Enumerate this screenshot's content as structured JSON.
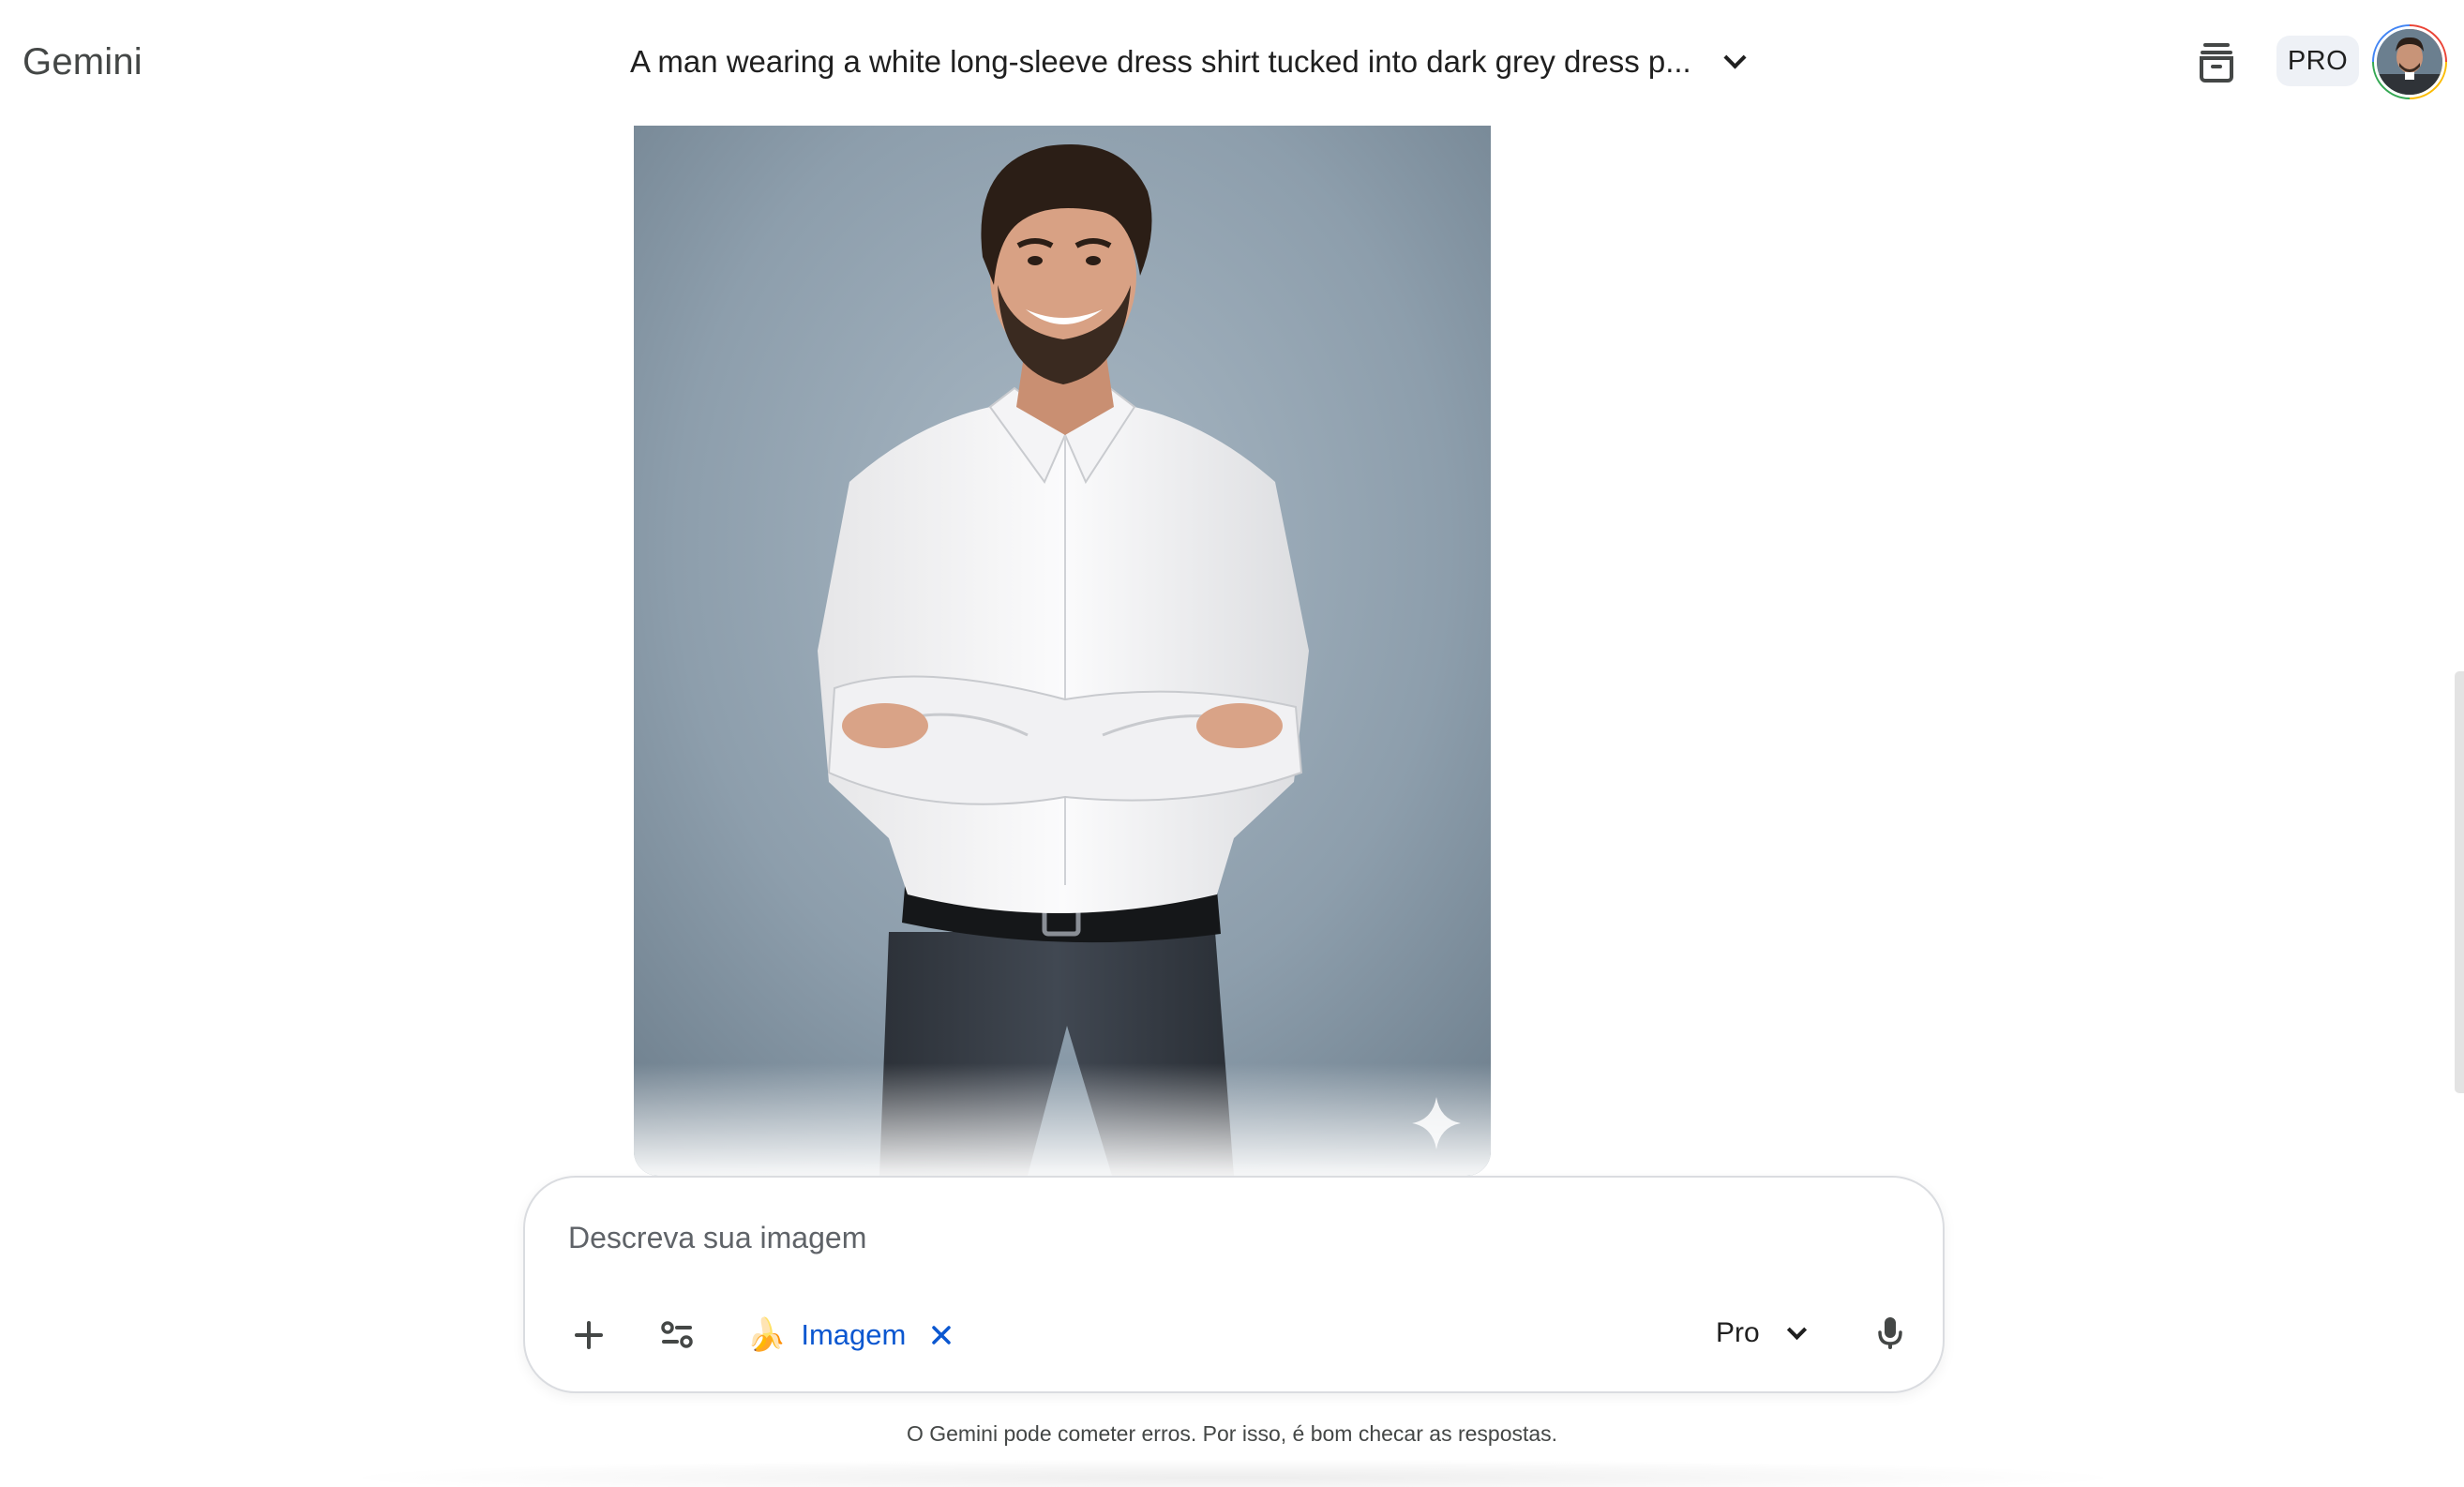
{
  "header": {
    "app_title": "Gemini",
    "conversation_title": "A man wearing a white long-sleeve dress shirt tucked into dark grey dress p...",
    "plan_badge": "PRO",
    "history_icon": "chat-history-icon",
    "avatar_icon": "user-avatar"
  },
  "main": {
    "generated_image": {
      "subject": "man in white shirt with arms crossed, dark grey trousers, grey backdrop",
      "watermark_icon": "gemini-sparkle-icon"
    }
  },
  "composer": {
    "placeholder": "Descreva sua imagem",
    "value": "",
    "add_icon": "plus-icon",
    "tools_icon": "tools-icon",
    "tool_chip": {
      "emoji": "🍌",
      "label": "Imagem",
      "close_icon": "close-icon"
    },
    "model": {
      "label": "Pro",
      "icon": "chevron-down-icon"
    },
    "mic_icon": "microphone-icon"
  },
  "footer": {
    "disclaimer": "O Gemini pode cometer erros. Por isso, é bom checar as respostas."
  },
  "colors": {
    "accent_blue": "#0b57d0",
    "text_primary": "#1f1f1f",
    "text_secondary": "#444746",
    "badge_bg": "#eef1f6",
    "border": "#dadce0"
  }
}
